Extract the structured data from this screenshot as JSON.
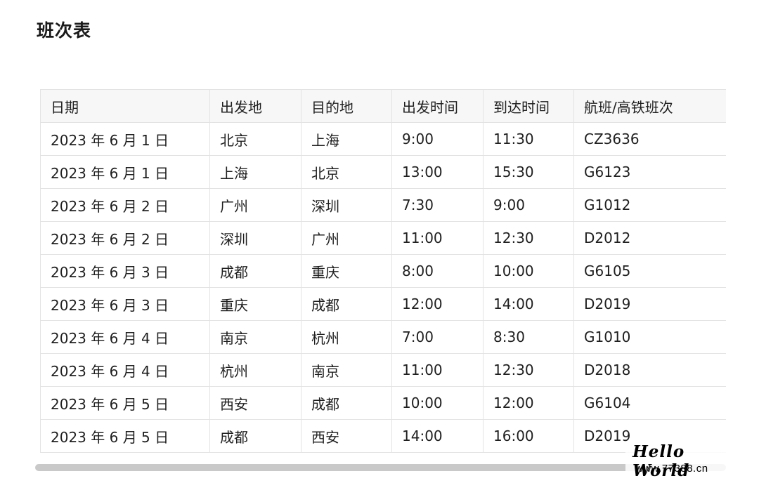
{
  "page": {
    "title": "班次表"
  },
  "table": {
    "headers": [
      "日期",
      "出发地",
      "目的地",
      "出发时间",
      "到达时间",
      "航班/高铁班次"
    ],
    "rows": [
      [
        "2023 年 6 月 1 日",
        "北京",
        "上海",
        "9:00",
        "11:30",
        "CZ3636"
      ],
      [
        "2023 年 6 月 1 日",
        "上海",
        "北京",
        "13:00",
        "15:30",
        "G6123"
      ],
      [
        "2023 年 6 月 2 日",
        "广州",
        "深圳",
        "7:30",
        "9:00",
        "G1012"
      ],
      [
        "2023 年 6 月 2 日",
        "深圳",
        "广州",
        "11:00",
        "12:30",
        "D2012"
      ],
      [
        "2023 年 6 月 3 日",
        "成都",
        "重庆",
        "8:00",
        "10:00",
        "G6105"
      ],
      [
        "2023 年 6 月 3 日",
        "重庆",
        "成都",
        "12:00",
        "14:00",
        "D2019"
      ],
      [
        "2023 年 6 月 4 日",
        "南京",
        "杭州",
        "7:00",
        "8:30",
        "G1010"
      ],
      [
        "2023 年 6 月 4 日",
        "杭州",
        "南京",
        "11:00",
        "12:30",
        "D2018"
      ],
      [
        "2023 年 6 月 5 日",
        "西安",
        "成都",
        "10:00",
        "12:00",
        "G6104"
      ],
      [
        "2023 年 6 月 5 日",
        "成都",
        "西安",
        "14:00",
        "16:00",
        "D2019"
      ]
    ]
  },
  "watermark": {
    "title": "Hello World",
    "url": "www.77388.cn"
  },
  "colors": {
    "header_bg": "#f7f7f7",
    "border": "#e3e3e3",
    "scrollbar": "#c9c9c9"
  }
}
